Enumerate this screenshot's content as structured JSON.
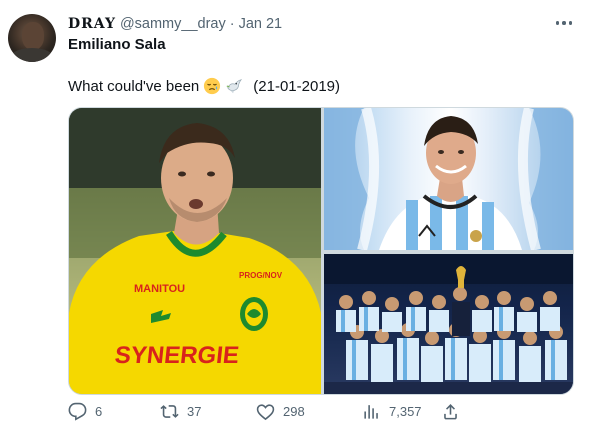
{
  "author": {
    "display_name": "DRAY",
    "handle": "@sammy__dray",
    "separator": "·",
    "date": "Jan 21"
  },
  "subtitle": "Emiliano Sala",
  "tweet": {
    "text_before": "What could've been",
    "emojis": [
      "sad-relieved-face-emoji",
      "dove-emoji"
    ],
    "text_after": "(21-01-2019)"
  },
  "media": {
    "left_jersey": {
      "sponsor_top": "MANITOU",
      "sponsor_main": "SYNERGIE",
      "sponsor_chest": "PROG/NOV"
    }
  },
  "actions": {
    "replies": "6",
    "retweets": "37",
    "likes": "298",
    "views": "7,357"
  },
  "colors": {
    "text_primary": "#0f1419",
    "text_secondary": "#536471",
    "border": "#cfd9de",
    "jersey_yellow": "#f5d800",
    "jersey_green": "#1e8a2e",
    "sponsor_red": "#d8231c"
  }
}
